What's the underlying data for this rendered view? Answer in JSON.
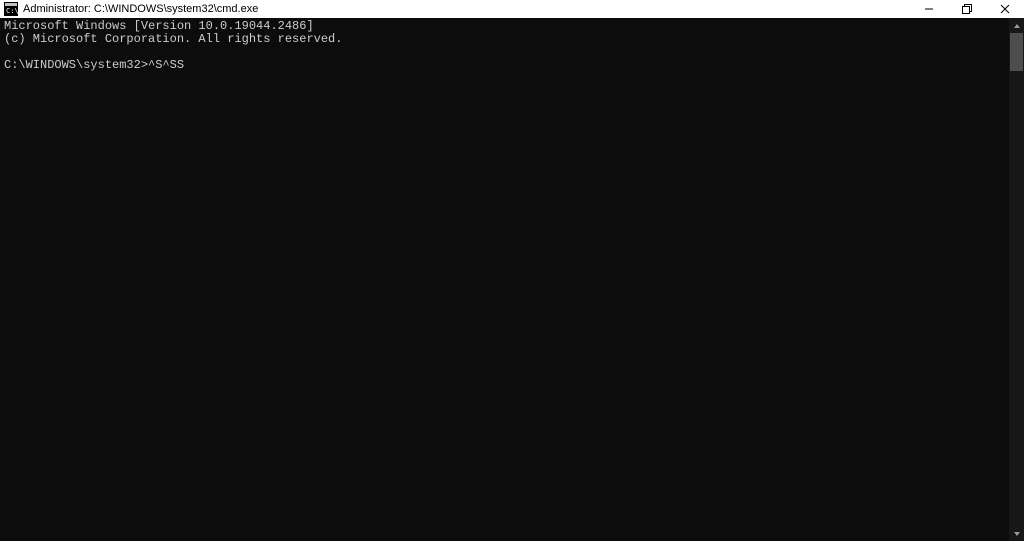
{
  "window": {
    "title": "Administrator: C:\\WINDOWS\\system32\\cmd.exe",
    "icon_name": "cmd-icon"
  },
  "terminal": {
    "line1": "Microsoft Windows [Version 10.0.19044.2486]",
    "line2": "(c) Microsoft Corporation. All rights reserved.",
    "prompt": "C:\\WINDOWS\\system32>",
    "input": "^S^SS"
  },
  "colors": {
    "terminal_bg": "#0c0c0c",
    "terminal_fg": "#cccccc",
    "titlebar_bg": "#ffffff"
  }
}
